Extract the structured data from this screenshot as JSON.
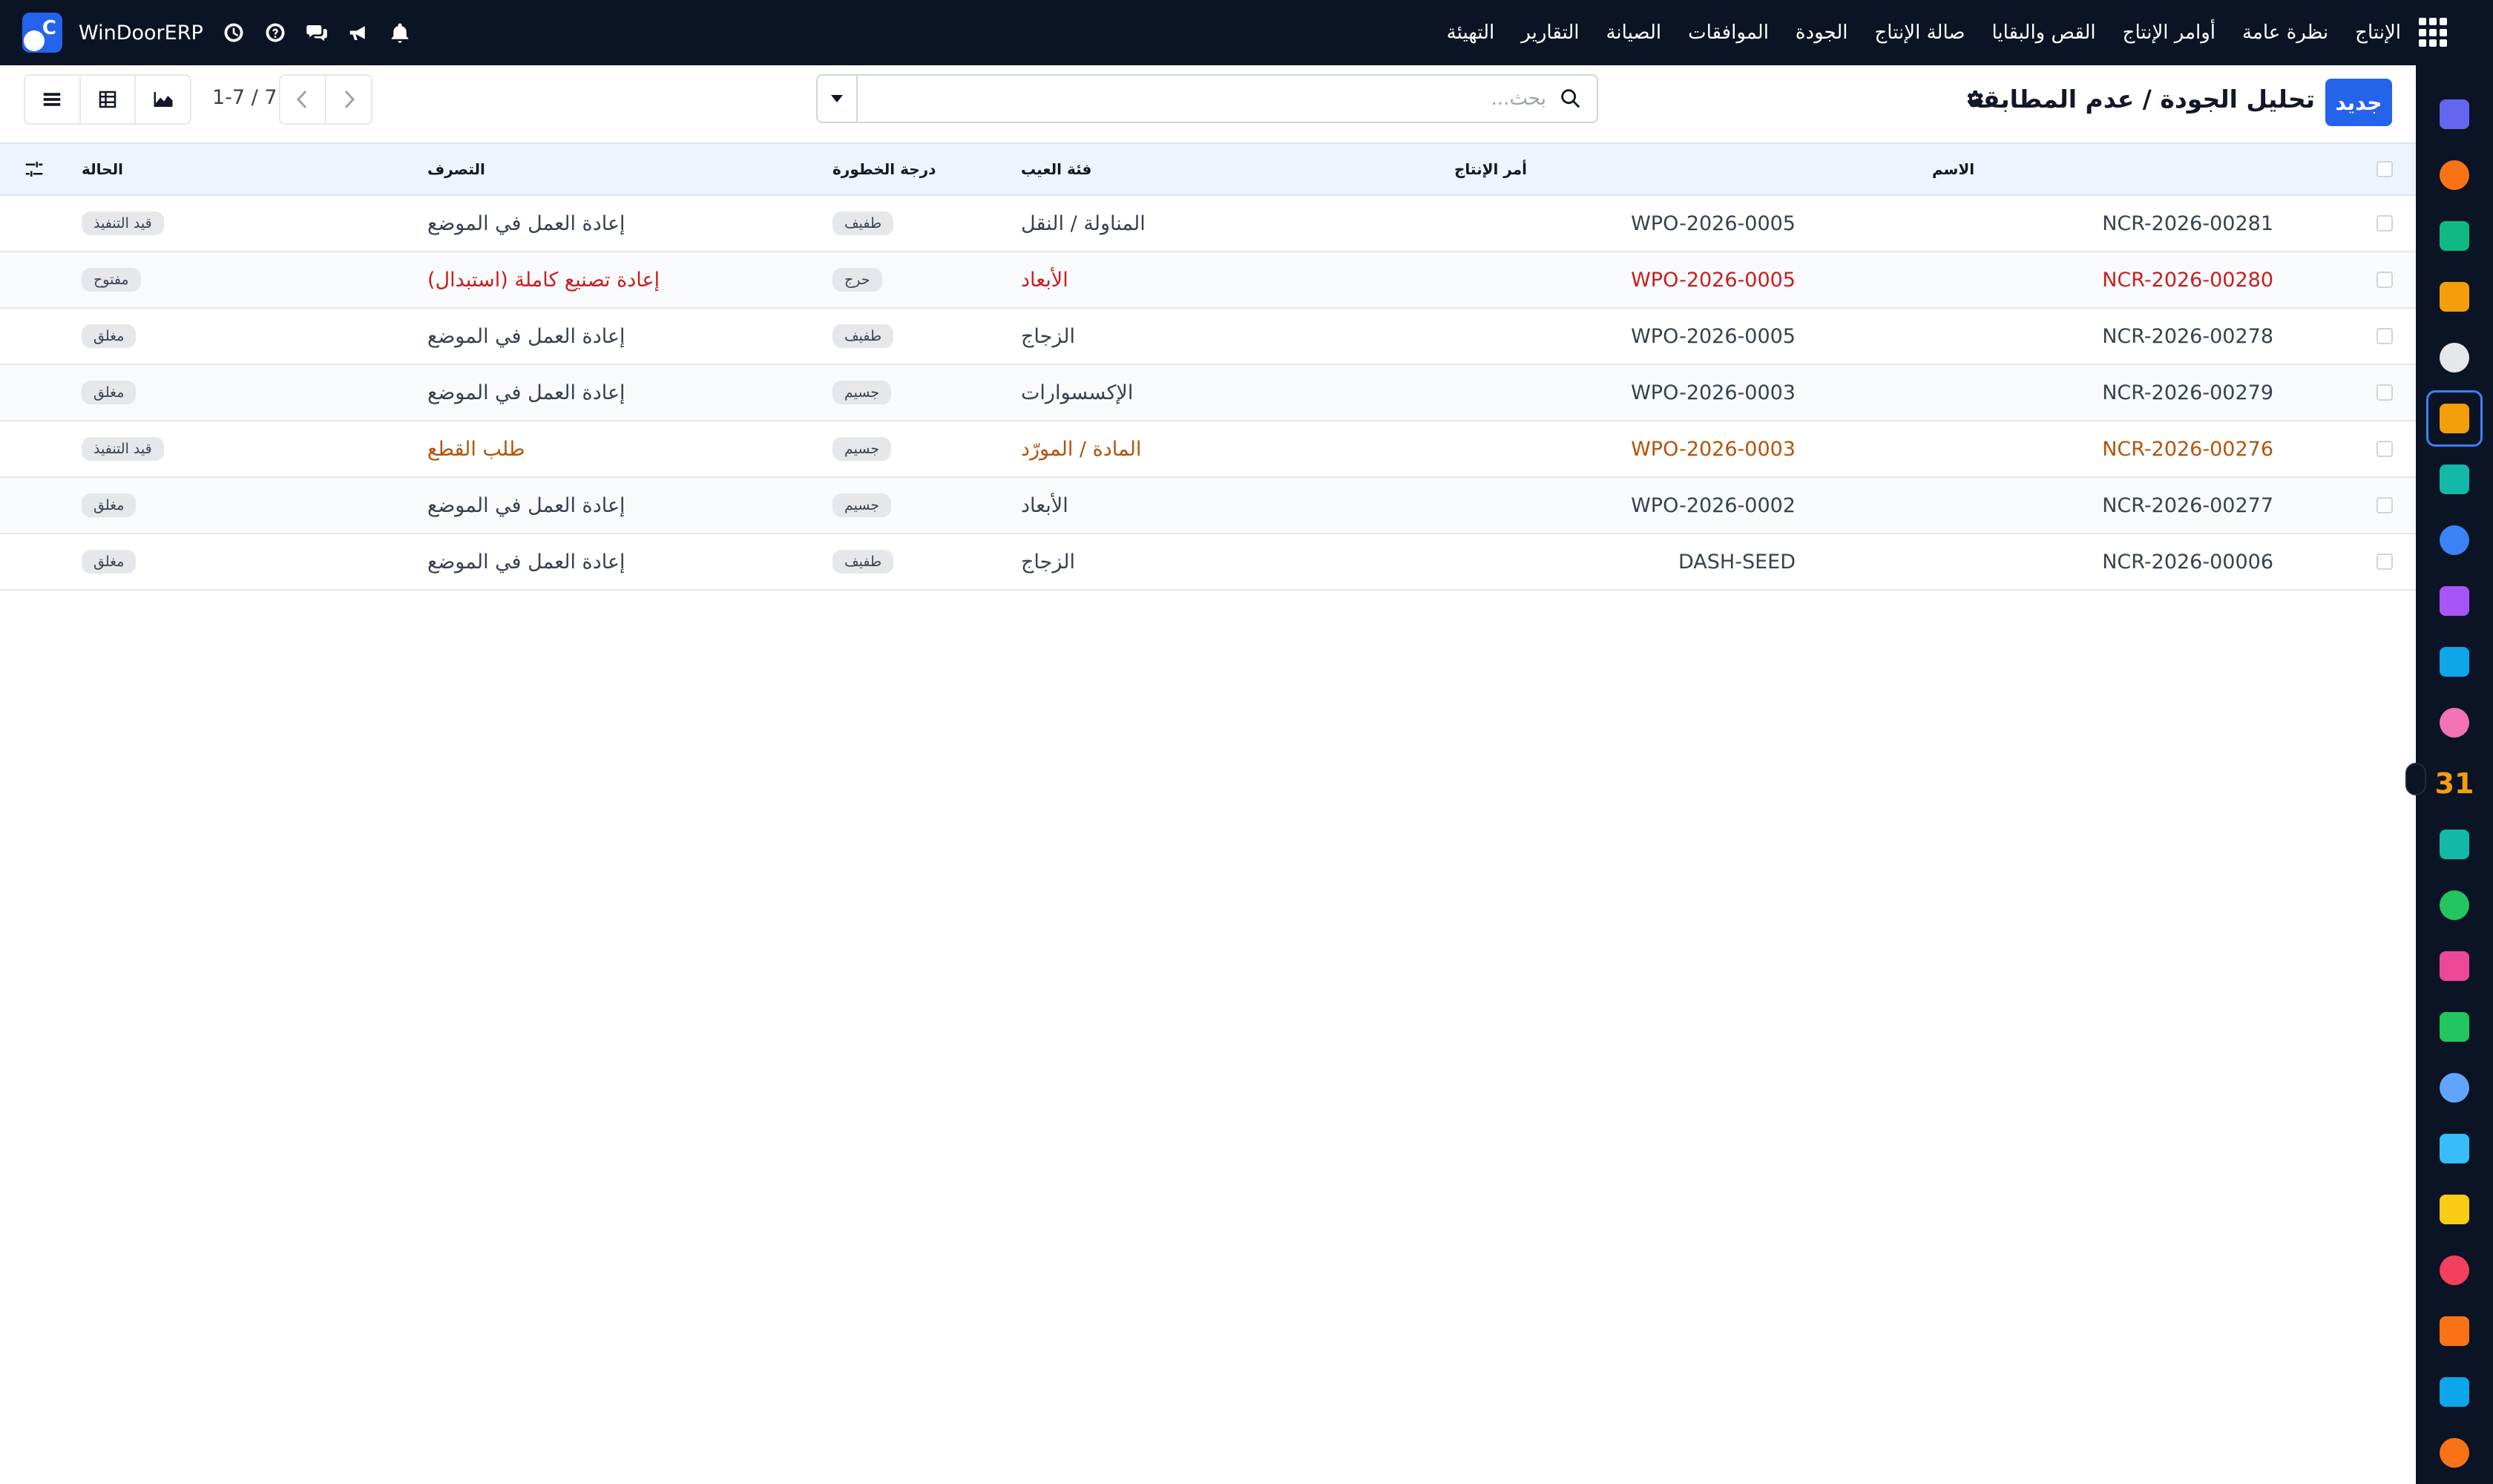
{
  "topbar": {
    "brand": "WinDoorERP",
    "menu": [
      "الإنتاج",
      "نظرة عامة",
      "أوامر الإنتاج",
      "القص والبقايا",
      "صالة الإنتاج",
      "الجودة",
      "الموافقات",
      "الصيانة",
      "التقارير",
      "التهيئة"
    ]
  },
  "control": {
    "new_label": "جديد",
    "title": "تحليل الجودة / عدم المطابقة",
    "search_placeholder": "بحث...",
    "pager": "1-7 / 7"
  },
  "table": {
    "headers": {
      "name": "الاسم",
      "order": "أمر الإنتاج",
      "category": "فئة العيب",
      "severity": "درجة الخطورة",
      "disposition": "التصرف",
      "status": "الحالة"
    },
    "rows": [
      {
        "name": "NCR-2026-00281",
        "order": "WPO-2026-0005",
        "category": "المناولة / النقل",
        "severity": "طفيف",
        "disposition": "إعادة العمل في الموضع",
        "status": "قيد التنفيذ",
        "tone": "normal"
      },
      {
        "name": "NCR-2026-00280",
        "order": "WPO-2026-0005",
        "category": "الأبعاد",
        "severity": "حرج",
        "disposition": "إعادة تصنيع كاملة (استبدال)",
        "status": "مفتوح",
        "tone": "danger"
      },
      {
        "name": "NCR-2026-00278",
        "order": "WPO-2026-0005",
        "category": "الزجاج",
        "severity": "طفيف",
        "disposition": "إعادة العمل في الموضع",
        "status": "مغلق",
        "tone": "normal"
      },
      {
        "name": "NCR-2026-00279",
        "order": "WPO-2026-0003",
        "category": "الإكسسوارات",
        "severity": "جسيم",
        "disposition": "إعادة العمل في الموضع",
        "status": "مغلق",
        "tone": "normal"
      },
      {
        "name": "NCR-2026-00276",
        "order": "WPO-2026-0003",
        "category": "المادة / المورّد",
        "severity": "جسيم",
        "disposition": "طلب القطع",
        "status": "قيد التنفيذ",
        "tone": "warning"
      },
      {
        "name": "NCR-2026-00277",
        "order": "WPO-2026-0002",
        "category": "الأبعاد",
        "severity": "جسيم",
        "disposition": "إعادة العمل في الموضع",
        "status": "مغلق",
        "tone": "normal"
      },
      {
        "name": "NCR-2026-00006",
        "order": "DASH-SEED",
        "category": "الزجاج",
        "severity": "طفيف",
        "disposition": "إعادة العمل في الموضع",
        "status": "مغلق",
        "tone": "normal"
      }
    ]
  },
  "appbar": {
    "icons": [
      {
        "name": "mail-app-icon",
        "color": "#6366f1"
      },
      {
        "name": "chat-bubble-app-icon",
        "color": "#f97316"
      },
      {
        "name": "diamond-app-icon",
        "color": "#10b981"
      },
      {
        "name": "bar-chart-app-icon",
        "color": "#f59e0b"
      },
      {
        "name": "cube-app-icon",
        "color": "#e5e7eb"
      },
      {
        "name": "quality-app-icon",
        "color": "#f59e0b",
        "active": true
      },
      {
        "name": "checkmark-app-icon",
        "color": "#14b8a6"
      },
      {
        "name": "book-app-icon",
        "color": "#3b82f6"
      },
      {
        "name": "box-app-icon",
        "color": "#a855f7"
      },
      {
        "name": "dollar-app-icon",
        "color": "#0ea5e9"
      },
      {
        "name": "people-app-icon",
        "color": "#f472b6"
      },
      {
        "name": "calendar-31-app-icon",
        "color": "#f59e0b",
        "text": "31"
      },
      {
        "name": "pen-app-icon",
        "color": "#14b8a6"
      },
      {
        "name": "contact-card-app-icon",
        "color": "#22c55e"
      },
      {
        "name": "dashboard-tiles-app-icon",
        "color": "#ec4899"
      },
      {
        "name": "whatsapp-app-icon",
        "color": "#22c55e"
      },
      {
        "name": "compass-app-icon",
        "color": "#60a5fa"
      },
      {
        "name": "wave-app-icon",
        "color": "#38bdf8"
      },
      {
        "name": "paper-plane-app-icon",
        "color": "#facc15"
      },
      {
        "name": "stacked-bars-app-icon",
        "color": "#f43f5e"
      },
      {
        "name": "hexagon-app-icon",
        "color": "#f97316"
      },
      {
        "name": "pie-app-icon",
        "color": "#0ea5e9"
      },
      {
        "name": "donut-app-icon",
        "color": "#f97316"
      }
    ]
  },
  "colors": {
    "topbar_bg": "#0b1424",
    "primary": "#2563eb",
    "danger_text": "#c81e1e",
    "warning_text": "#b45309",
    "header_bg": "#eef4fc"
  }
}
